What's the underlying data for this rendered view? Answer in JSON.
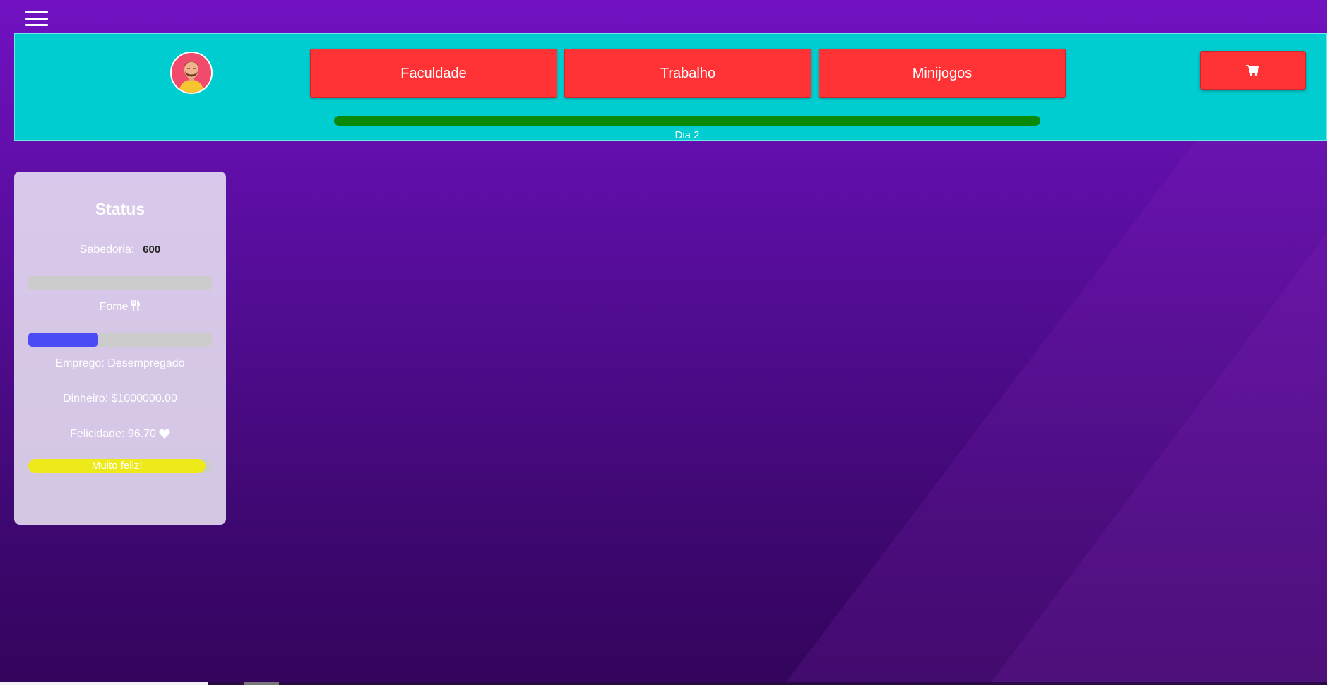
{
  "nav": {
    "menu_icon": "hamburger-menu-icon",
    "buttons": [
      "Faculdade",
      "Trabalho",
      "Minijogos"
    ],
    "cart_icon": "shopping-cart-icon"
  },
  "day": {
    "label": "Dia 2",
    "progress_fraction": 1.0
  },
  "status": {
    "title": "Status",
    "sabedoria_label": "Sabedoria:",
    "sabedoria_value": "600",
    "sabedoria_progress_fraction": 0.0,
    "fome_label": "Fome",
    "fome_icon": "utensils-icon",
    "fome_progress_fraction": 0.38,
    "emprego_text": "Emprego: Desempregado",
    "dinheiro_text": "Dinheiro: $1000000.00",
    "felicidade_text": "Felicidade: 96.70",
    "felicidade_icon": "heart-icon",
    "felicidade_progress_fraction": 0.967,
    "felicidade_bar_label": "Muito feliz!"
  },
  "colors": {
    "background_top": "#7211c2",
    "background_bottom": "#33055c",
    "header": "#00cdd0",
    "button": "#ff3336",
    "day_bar": "#0a8a0a",
    "fome_bar": "#4b4bf5",
    "happy_bar": "#eeea1a",
    "bar_track": "#cccccc"
  }
}
